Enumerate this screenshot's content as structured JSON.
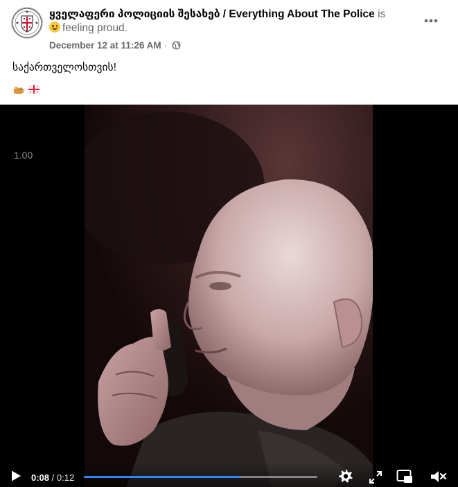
{
  "post": {
    "page_name": "ყველაფერი პოლიციის შესახებ / Everything About The Police",
    "is_word": "is",
    "feeling": "feeling proud.",
    "date": "December 12 at 11:26 AM",
    "separator": "·",
    "privacy_icon": "globe-icon",
    "more_icon": "more-horizontal-icon",
    "text": "საქართველოსთვის!",
    "emojis": [
      "flexed-biceps",
      "georgia-flag"
    ]
  },
  "video": {
    "playback_speed": "1.00",
    "current_time": "0:08",
    "time_separator": " / ",
    "duration": "0:12",
    "progress": 0.67,
    "icons": [
      "play-icon",
      "settings-icon",
      "fullscreen-icon",
      "picture-in-picture-icon",
      "muted-volume-icon"
    ]
  },
  "colors": {
    "text_primary": "#050505",
    "text_secondary": "#65676b",
    "progress_accent": "#2d88ff",
    "video_background": "#000000"
  }
}
